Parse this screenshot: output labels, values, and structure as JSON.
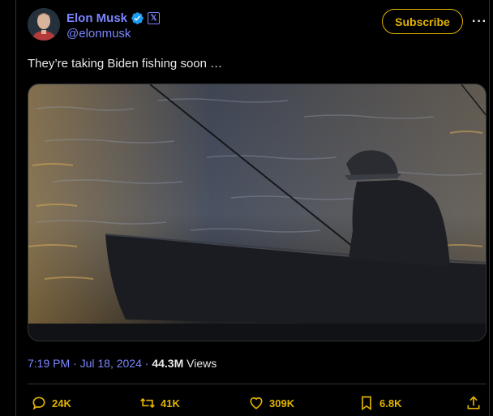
{
  "author": {
    "display_name": "Elon Musk",
    "handle": "@elonmusk",
    "x_badge": "𝕏"
  },
  "header": {
    "subscribe_label": "Subscribe",
    "more_label": "···"
  },
  "tweet": {
    "text": "They’re taking Biden fishing soon …",
    "image": {
      "kind": "photo",
      "subject": "silhouette-fisherman-rowboat"
    }
  },
  "meta": {
    "time": "7:19 PM",
    "separator": "·",
    "date": "Jul 18, 2024",
    "views_count": "44.3M",
    "views_label": "Views"
  },
  "actions": {
    "replies": "24K",
    "reposts": "41K",
    "likes": "309K",
    "bookmarks": "6.8K"
  },
  "colors": {
    "accent": "#7b86ff",
    "gold": "#e0b400",
    "verified": "#1d9bf0",
    "border": "#2f3336"
  },
  "icons": [
    "verified-icon",
    "x-premium-icon",
    "more-icon",
    "reply-icon",
    "repost-icon",
    "like-icon",
    "bookmark-icon",
    "share-icon"
  ]
}
